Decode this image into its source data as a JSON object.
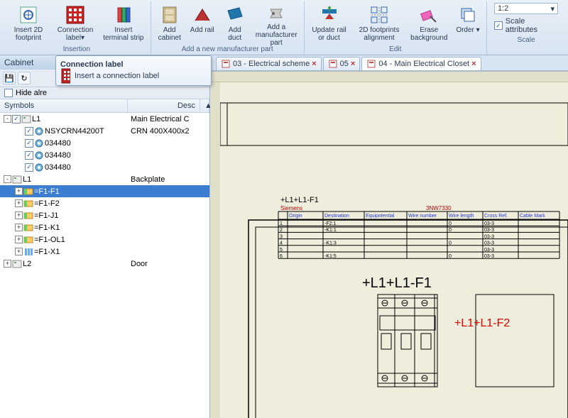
{
  "ribbon": {
    "groups": [
      {
        "label": "Insertion",
        "btns": [
          {
            "name": "insert-2d-footprint",
            "label": "Insert 2D\nfootprint"
          },
          {
            "name": "connection-label",
            "label": "Connection\nlabel▾"
          },
          {
            "name": "insert-terminal-strip",
            "label": "Insert\nterminal strip"
          }
        ]
      },
      {
        "label": "Add a new manufacturer part",
        "btns": [
          {
            "name": "add-cabinet",
            "label": "Add\ncabinet"
          },
          {
            "name": "add-rail",
            "label": "Add\nrail"
          },
          {
            "name": "add-duct",
            "label": "Add\nduct"
          },
          {
            "name": "add-mfr-part",
            "label": "Add a\nmanufacturer part"
          }
        ]
      },
      {
        "label": "Edit",
        "btns": [
          {
            "name": "update-rail-duct",
            "label": "Update rail\nor duct"
          },
          {
            "name": "2d-footprints-alignment",
            "label": "2D footprints\nalignment"
          },
          {
            "name": "erase-background",
            "label": "Erase\nbackground"
          },
          {
            "name": "order",
            "label": "Order\n▾"
          }
        ]
      }
    ],
    "scale_group_label": "Scale",
    "scale_value": "1:2",
    "scale_attr_label": "Scale attributes",
    "scale_attr_checked": true
  },
  "tooltip": {
    "title": "Connection label",
    "body": "Insert a connection label"
  },
  "panel": {
    "title": "Cabinet",
    "hide_already_label": "Hide alre",
    "col_symbols": "Symbols",
    "col_desc": "Desc",
    "rows": [
      {
        "depth": 0,
        "exp": "-",
        "chk": true,
        "icon": "board",
        "name": "L1",
        "desc": "Main Electrical C"
      },
      {
        "depth": 1,
        "chk": true,
        "icon": "gear",
        "name": "NSYCRN44200T",
        "desc": "CRN 400X400x2"
      },
      {
        "depth": 1,
        "chk": true,
        "icon": "gear",
        "name": "034480",
        "desc": ""
      },
      {
        "depth": 1,
        "chk": true,
        "icon": "gear",
        "name": "034480",
        "desc": ""
      },
      {
        "depth": 1,
        "chk": true,
        "icon": "gear",
        "name": "034480",
        "desc": ""
      },
      {
        "depth": 0,
        "exp": "-",
        "icon": "board",
        "name": "L1",
        "desc": "Backplate"
      },
      {
        "depth": 1,
        "exp": "+",
        "icon": "comp",
        "name": "=F1-F1",
        "desc": "",
        "sel": true
      },
      {
        "depth": 1,
        "exp": "+",
        "icon": "comp",
        "name": "=F1-F2",
        "desc": ""
      },
      {
        "depth": 1,
        "exp": "+",
        "icon": "comp",
        "name": "=F1-J1",
        "desc": ""
      },
      {
        "depth": 1,
        "exp": "+",
        "icon": "comp",
        "name": "=F1-K1",
        "desc": ""
      },
      {
        "depth": 1,
        "exp": "+",
        "icon": "comp",
        "name": "=F1-OL1",
        "desc": ""
      },
      {
        "depth": 1,
        "exp": "+",
        "icon": "term",
        "name": "=F1-X1",
        "desc": ""
      },
      {
        "depth": 0,
        "exp": "+",
        "icon": "board",
        "name": "L2",
        "desc": "Door"
      }
    ]
  },
  "tabs": [
    {
      "name": "tab-03",
      "label": "03 - Electrical scheme",
      "active": false
    },
    {
      "name": "tab-05",
      "label": "05",
      "active": false
    },
    {
      "name": "tab-04",
      "label": "04 - Main Electrical Closet",
      "active": true
    }
  ],
  "drawing": {
    "title": "+L1+L1-F1",
    "mfr": "Siemens",
    "part": "3NW7330",
    "table_headers": [
      "",
      "Origin",
      "Destination",
      "Equipotential",
      "Wire number",
      "Wire length",
      "Cross Ref.",
      "Cable Mark"
    ],
    "table_rows": [
      [
        "1",
        "",
        "-F2:1",
        "",
        "",
        "0",
        "03-3",
        ""
      ],
      [
        "2",
        "",
        "-K1:1",
        "",
        "",
        "0",
        "03-3",
        ""
      ],
      [
        "3",
        "",
        "",
        "",
        "",
        "",
        "03-3",
        ""
      ],
      [
        "4",
        "",
        "-K1:3",
        "",
        "",
        "0",
        "03-3",
        ""
      ],
      [
        "5",
        "",
        "",
        "",
        "",
        "",
        "03-3",
        ""
      ],
      [
        "6",
        "",
        "-K1:5",
        "",
        "",
        "0",
        "03-3",
        ""
      ]
    ],
    "comp_label": "+L1+L1-F1",
    "comp2_label": "+L1+L1-F2"
  }
}
